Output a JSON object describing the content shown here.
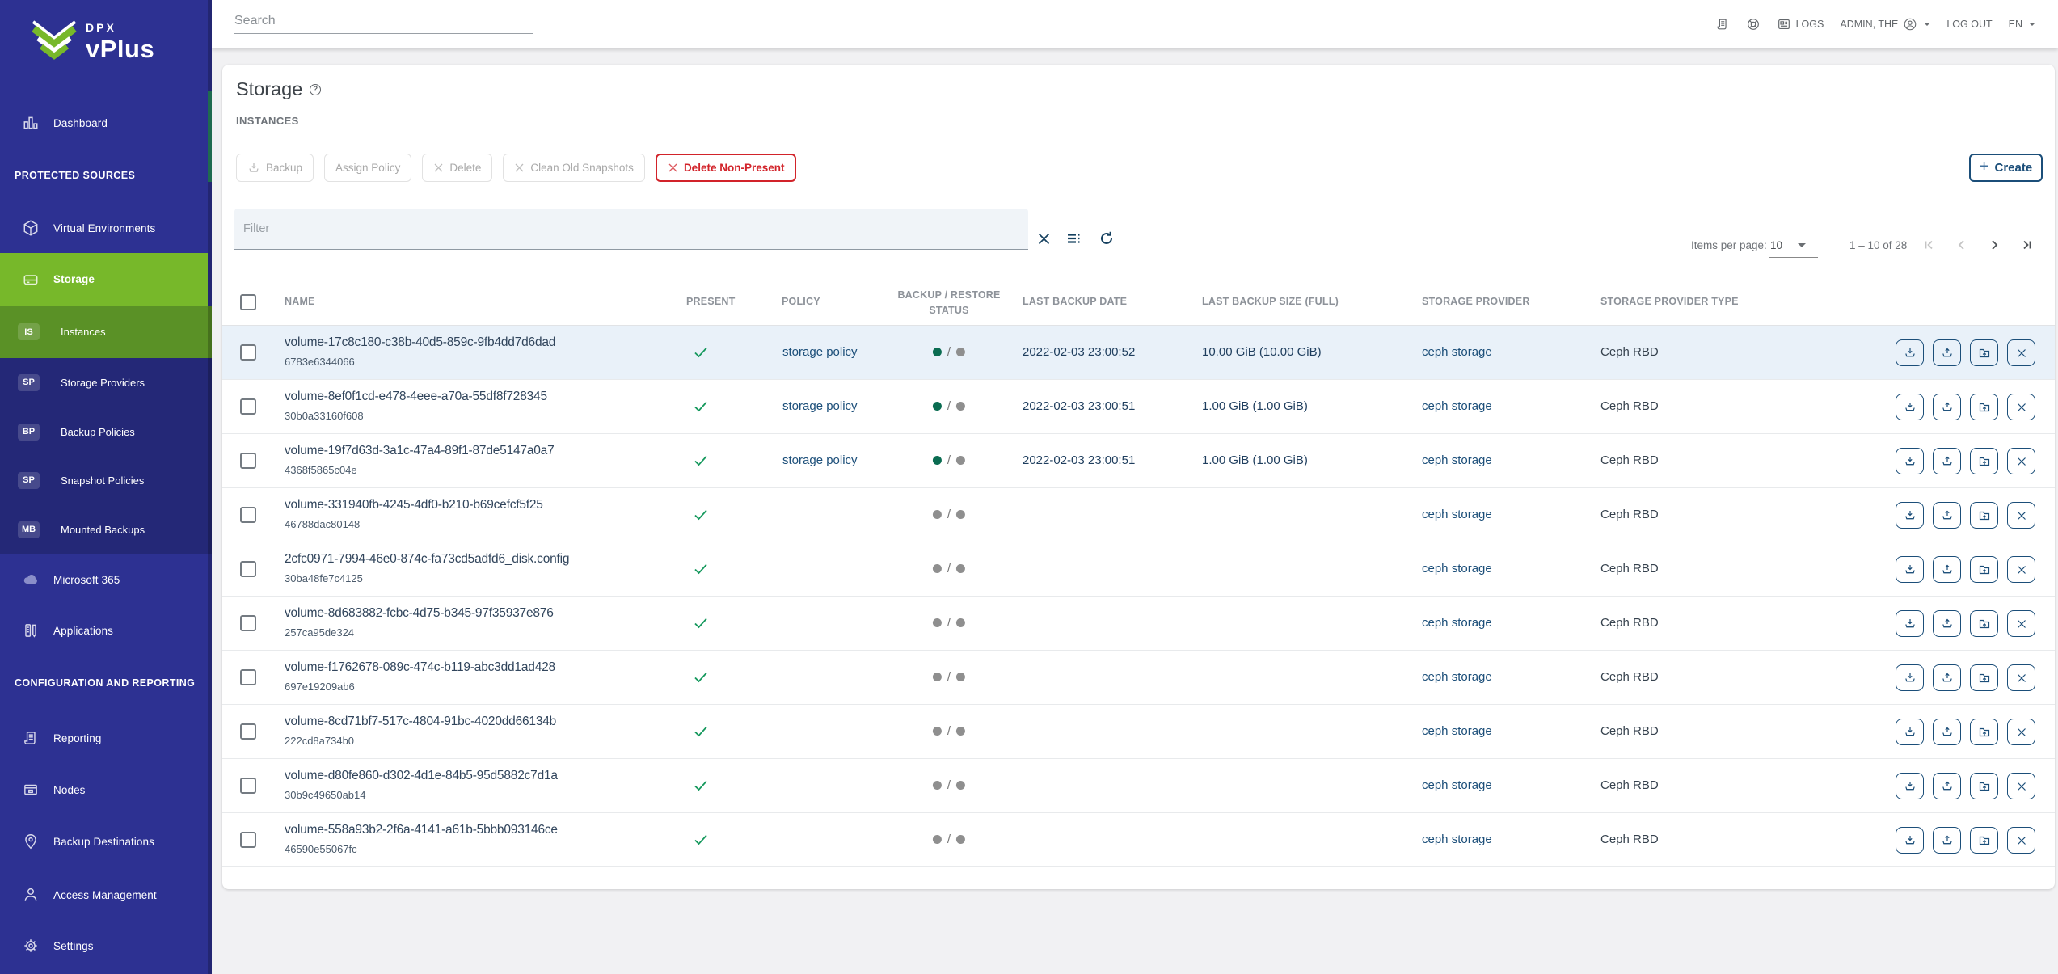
{
  "brand": {
    "line1": "DPX",
    "line2": "vPlus"
  },
  "topbar": {
    "search_placeholder": "Search",
    "logs_label": "LOGS",
    "admin_label": "ADMIN, THE",
    "logout_label": "LOG OUT",
    "lang_label": "EN"
  },
  "sidebar": {
    "items": [
      {
        "label": "Dashboard"
      },
      {
        "label": "PROTECTED SOURCES"
      },
      {
        "label": "Virtual Environments"
      },
      {
        "label": "Storage"
      },
      {
        "label": "Instances",
        "badge": "IS"
      },
      {
        "label": "Storage Providers",
        "badge": "SP"
      },
      {
        "label": "Backup Policies",
        "badge": "BP"
      },
      {
        "label": "Snapshot Policies",
        "badge": "SP"
      },
      {
        "label": "Mounted Backups",
        "badge": "MB"
      },
      {
        "label": "Microsoft 365"
      },
      {
        "label": "Applications"
      },
      {
        "label": "CONFIGURATION AND REPORTING"
      },
      {
        "label": "Reporting"
      },
      {
        "label": "Nodes"
      },
      {
        "label": "Backup Destinations"
      },
      {
        "label": "Access Management"
      },
      {
        "label": "Settings"
      }
    ]
  },
  "page": {
    "title": "Storage",
    "subtitle": "INSTANCES"
  },
  "toolbar": {
    "backup": "Backup",
    "assign_policy": "Assign Policy",
    "delete": "Delete",
    "clean": "Clean Old Snapshots",
    "delete_non_present": "Delete Non-Present",
    "create": "Create"
  },
  "filter": {
    "placeholder": "Filter"
  },
  "pagination": {
    "items_per_page_label": "Items per page:",
    "items_per_page": "10",
    "range": "1 – 10 of 28"
  },
  "table": {
    "columns": [
      "NAME",
      "PRESENT",
      "POLICY",
      "BACKUP / RESTORE",
      "STATUS",
      "LAST BACKUP DATE",
      "LAST BACKUP SIZE (FULL)",
      "STORAGE PROVIDER",
      "STORAGE PROVIDER TYPE"
    ],
    "rows": [
      {
        "name": "volume-17c8c180-c38b-40d5-859c-9fb4dd7d6dad",
        "id": "6783e6344066",
        "policy": "storage policy",
        "backup_ok": true,
        "date": "2022-02-03 23:00:52",
        "size": "10.00 GiB (10.00 GiB)",
        "provider": "ceph storage",
        "type": "Ceph RBD",
        "active": true
      },
      {
        "name": "volume-8ef0f1cd-e478-4eee-a70a-55df8f728345",
        "id": "30b0a33160f608",
        "policy": "storage policy",
        "backup_ok": true,
        "date": "2022-02-03 23:00:51",
        "size": "1.00 GiB (1.00 GiB)",
        "provider": "ceph storage",
        "type": "Ceph RBD",
        "active": false
      },
      {
        "name": "volume-19f7d63d-3a1c-47a4-89f1-87de5147a0a7",
        "id": "4368f5865c04e",
        "policy": "storage policy",
        "backup_ok": true,
        "date": "2022-02-03 23:00:51",
        "size": "1.00 GiB (1.00 GiB)",
        "provider": "ceph storage",
        "type": "Ceph RBD",
        "active": false
      },
      {
        "name": "volume-331940fb-4245-4df0-b210-b69cefcf5f25",
        "id": "46788dac80148",
        "policy": "",
        "backup_ok": false,
        "date": "",
        "size": "",
        "provider": "ceph storage",
        "type": "Ceph RBD",
        "active": false
      },
      {
        "name": "2cfc0971-7994-46e0-874c-fa73cd5adfd6_disk.config",
        "id": "30ba48fe7c4125",
        "policy": "",
        "backup_ok": false,
        "date": "",
        "size": "",
        "provider": "ceph storage",
        "type": "Ceph RBD",
        "active": false
      },
      {
        "name": "volume-8d683882-fcbc-4d75-b345-97f35937e876",
        "id": "257ca95de324",
        "policy": "",
        "backup_ok": false,
        "date": "",
        "size": "",
        "provider": "ceph storage",
        "type": "Ceph RBD",
        "active": false
      },
      {
        "name": "volume-f1762678-089c-474c-b119-abc3dd1ad428",
        "id": "697e19209ab6",
        "policy": "",
        "backup_ok": false,
        "date": "",
        "size": "",
        "provider": "ceph storage",
        "type": "Ceph RBD",
        "active": false
      },
      {
        "name": "volume-8cd71bf7-517c-4804-91bc-4020dd66134b",
        "id": "222cd8a734b0",
        "policy": "",
        "backup_ok": false,
        "date": "",
        "size": "",
        "provider": "ceph storage",
        "type": "Ceph RBD",
        "active": false
      },
      {
        "name": "volume-d80fe860-d302-4d1e-84b5-95d5882c7d1a",
        "id": "30b9c49650ab14",
        "policy": "",
        "backup_ok": false,
        "date": "",
        "size": "",
        "provider": "ceph storage",
        "type": "Ceph RBD",
        "active": false
      },
      {
        "name": "volume-558a93b2-2f6a-4141-a61b-5bbb093146ce",
        "id": "46590e55067fc",
        "policy": "",
        "backup_ok": false,
        "date": "",
        "size": "",
        "provider": "ceph storage",
        "type": "Ceph RBD",
        "active": false
      }
    ]
  },
  "colors": {
    "sidebar": "#2d3192",
    "accent_green": "#77b82a",
    "link": "#1b4e79",
    "red": "#d2232a",
    "status_green": "#0a6c51",
    "status_grey": "#8f8f8f"
  }
}
